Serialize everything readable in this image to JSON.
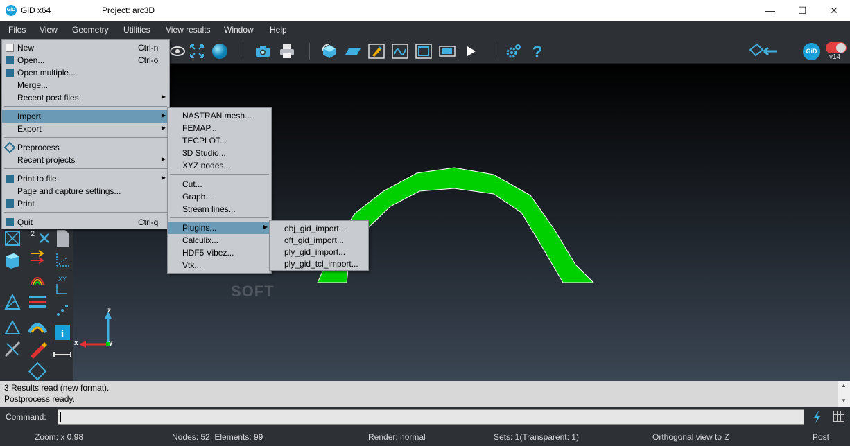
{
  "window": {
    "app_title": "GiD x64",
    "project_title": "Project: arc3D",
    "app_icon_text": "GiD",
    "minimize": "—",
    "maximize": "☐",
    "close": "✕"
  },
  "menubar": [
    {
      "label": "Files"
    },
    {
      "label": "View"
    },
    {
      "label": "Geometry"
    },
    {
      "label": "Utilities"
    },
    {
      "label": "View results"
    },
    {
      "label": "Window"
    },
    {
      "label": "Help"
    }
  ],
  "toolbar": {
    "gid_badge": "GiD",
    "version": "v14"
  },
  "files_menu": {
    "items": [
      {
        "label": "New",
        "shortcut": "Ctrl-n"
      },
      {
        "label": "Open...",
        "shortcut": "Ctrl-o"
      },
      {
        "label": "Open multiple..."
      },
      {
        "label": "Merge..."
      },
      {
        "label": "Recent post files"
      },
      {
        "label": "Import"
      },
      {
        "label": "Export"
      },
      {
        "label": "Preprocess"
      },
      {
        "label": "Recent projects"
      },
      {
        "label": "Print to file"
      },
      {
        "label": "Page and capture settings..."
      },
      {
        "label": "Print"
      },
      {
        "label": "Quit",
        "shortcut": "Ctrl-q"
      }
    ]
  },
  "import_menu": {
    "items": [
      {
        "label": "NASTRAN mesh..."
      },
      {
        "label": "FEMAP..."
      },
      {
        "label": "TECPLOT..."
      },
      {
        "label": "3D Studio..."
      },
      {
        "label": "XYZ nodes..."
      },
      {
        "label": "Cut..."
      },
      {
        "label": "Graph..."
      },
      {
        "label": "Stream lines..."
      },
      {
        "label": "Plugins..."
      },
      {
        "label": "Calculix..."
      },
      {
        "label": "HDF5 Vibez..."
      },
      {
        "label": "Vtk..."
      }
    ]
  },
  "plugins_menu": {
    "items": [
      {
        "label": "obj_gid_import..."
      },
      {
        "label": "off_gid_import..."
      },
      {
        "label": "ply_gid_import..."
      },
      {
        "label": "ply_gid_tcl_import..."
      }
    ]
  },
  "axes": {
    "z": "z",
    "x": "x",
    "y": "y"
  },
  "left_tools": {
    "label_2x": "2",
    "label_xy": "XY"
  },
  "status": {
    "line1": "3 Results read (new format).",
    "line2": "Postprocess ready."
  },
  "command": {
    "label": "Command:",
    "value": ""
  },
  "footer": {
    "zoom": "Zoom: x 0.98",
    "nodes": "Nodes: 52, Elements: 99",
    "render": "Render: normal",
    "sets": "Sets: 1(Transparent: 1)",
    "view": "Orthogonal view to Z",
    "mode": "Post"
  },
  "colors": {
    "model_green": "#00d000",
    "menu_bg": "#c8ccd0",
    "menu_highlight": "#6a9ab6",
    "chrome": "#2d3136",
    "accent_blue": "#1aa0d8"
  }
}
